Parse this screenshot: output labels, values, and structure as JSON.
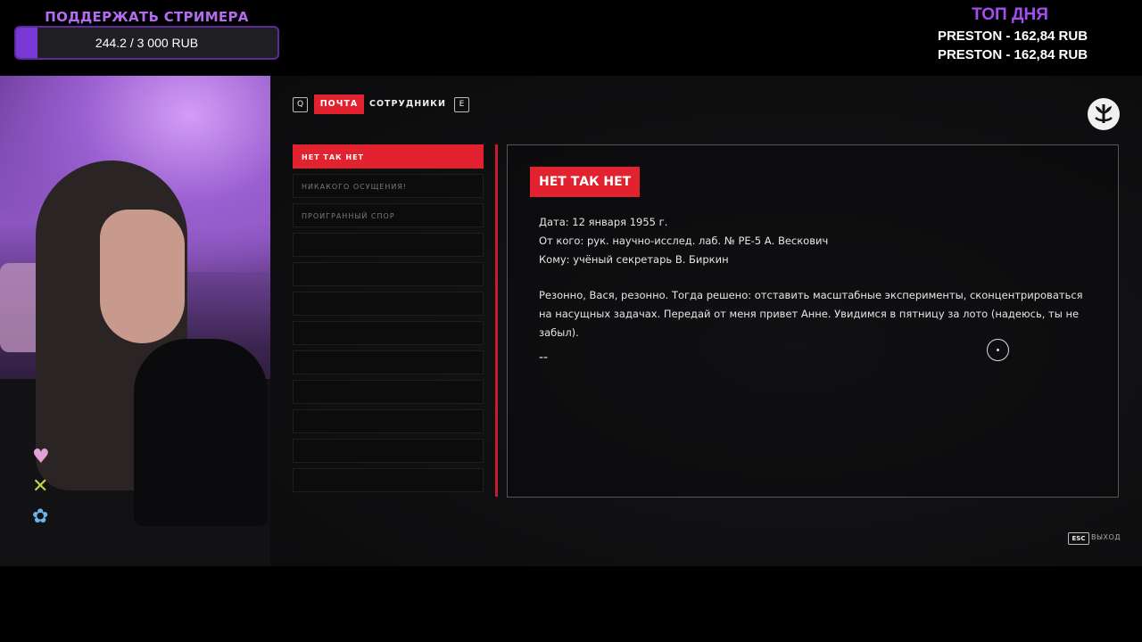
{
  "overlay": {
    "donate_title": "ПОДДЕРЖАТЬ СТРИМЕРА",
    "donate_progress": "244.2 / 3 000 RUB",
    "donate_fraction": 0.0814,
    "top_title": "ТОП ДНЯ",
    "top_entries": [
      "PRESTON - 162,84 RUB",
      "PRESTON - 162,84 RUB"
    ]
  },
  "nav": {
    "prev_key": "Q",
    "next_key": "E",
    "tabs": [
      {
        "label": "ПОЧТА",
        "active": true
      },
      {
        "label": "СОТРУДНИКИ",
        "active": false
      }
    ]
  },
  "mail_list": [
    "НЕТ ТАК НЕТ",
    "НИКАКОГО ОСУЩЕНИЯ!",
    "ПРОИГРАННЫЙ СПОР",
    "",
    "",
    "",
    "",
    "",
    "",
    "",
    "",
    ""
  ],
  "email": {
    "subject": "НЕТ ТАК НЕТ",
    "date": "Дата: 12 января 1955 г.",
    "from": "От кого: рук. научно-исслед. лаб. № РЕ-5 А. Вескович",
    "to": "Кому: учёный секретарь В. Биркин",
    "body": "Резонно, Вася, резонно. Тогда решено: отставить масштабные эксперименты, сконцентрироваться на насущных задачах. Передай от меня привет Анне. Увидимся в пятницу за лото (надеюсь, ты не забыл).",
    "signature": "--"
  },
  "footer": {
    "esc_key": "ESC",
    "exit_label": "ВЫХОД"
  },
  "colors": {
    "accent_red": "#e3222f",
    "overlay_purple": "#a44ef2"
  }
}
